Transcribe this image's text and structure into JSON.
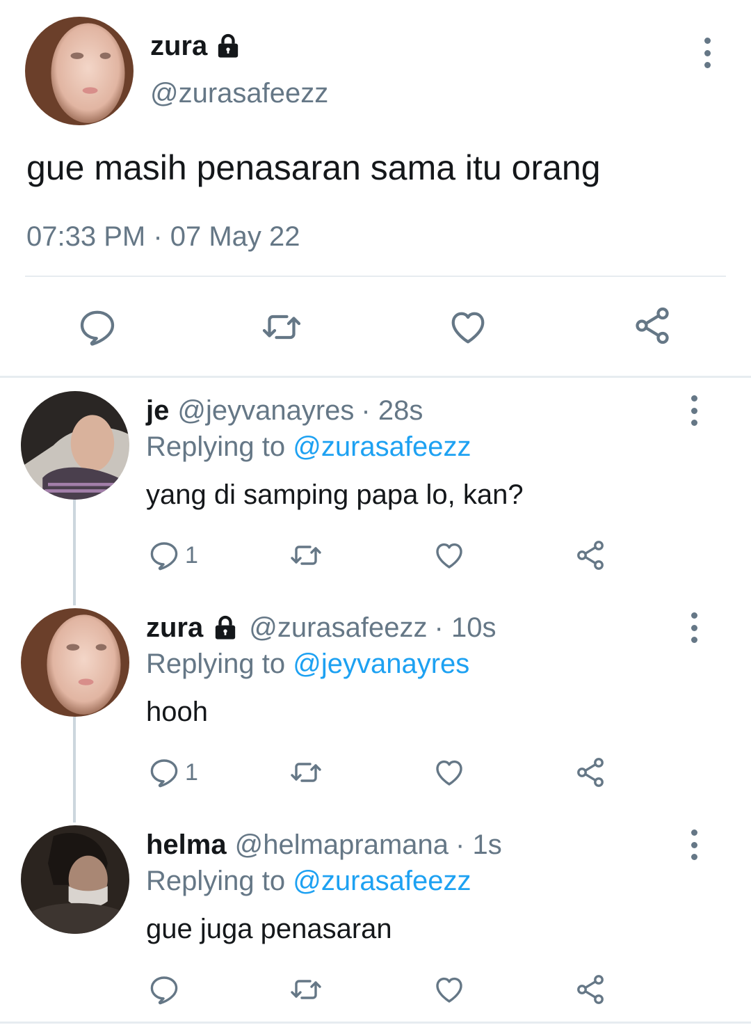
{
  "main_tweet": {
    "name": "zura",
    "handle": "@zurasafeezz",
    "text": "gue masih penasaran sama itu orang",
    "timestamp": "07:33 PM · 07 May 22",
    "locked": true
  },
  "replies": [
    {
      "name": "je",
      "handle": "@jeyvanayres",
      "time": "· 28s",
      "replying_prefix": "Replying to ",
      "replying_to": "@zurasafeezz",
      "text": "yang di samping papa lo, kan?",
      "reply_count": "1",
      "locked": false
    },
    {
      "name": "zura",
      "handle": "@zurasafeezz",
      "time": "· 10s",
      "replying_prefix": "Replying to ",
      "replying_to": "@jeyvanayres",
      "text": "hooh",
      "reply_count": "1",
      "locked": true
    },
    {
      "name": "helma",
      "handle": "@helmapramana",
      "time": "· 1s",
      "replying_prefix": "Replying to ",
      "replying_to": "@zurasafeezz",
      "text": "gue juga penasaran",
      "reply_count": "",
      "locked": false
    }
  ],
  "colors": {
    "text_primary": "#14171a",
    "text_secondary": "#657786",
    "mention": "#1da1f2",
    "divider": "#e6ecf0",
    "thread_line": "#ccd6dd"
  },
  "icons": [
    "lock-icon",
    "more-vertical-icon",
    "reply-icon",
    "retweet-icon",
    "like-icon",
    "share-icon"
  ]
}
